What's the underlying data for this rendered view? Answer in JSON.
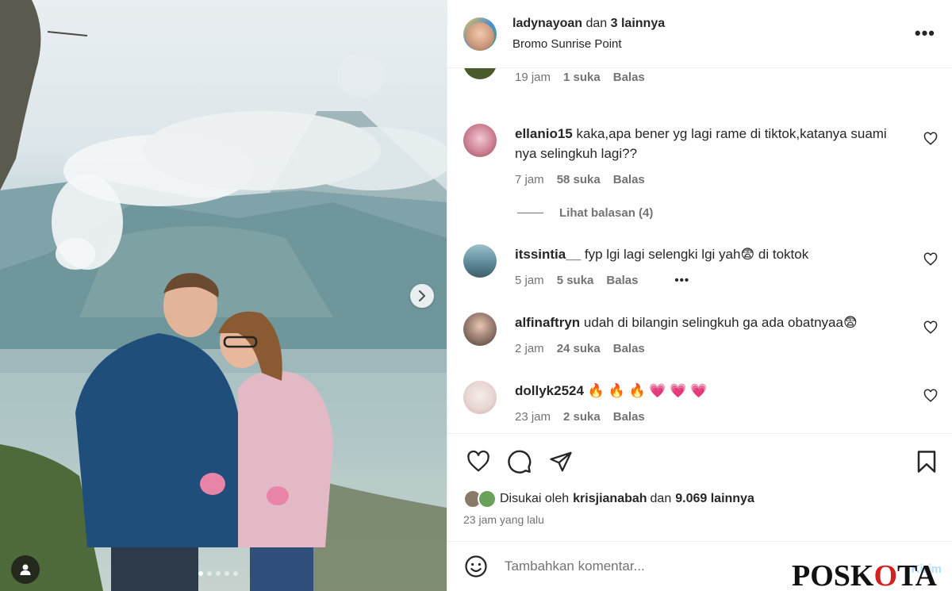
{
  "post": {
    "header_user": "ladynayoan",
    "header_and": "dan",
    "header_others": "3 lainnya",
    "location": "Bromo Sunrise Point",
    "more_icon": "more-horizontal-icon"
  },
  "comments": [
    {
      "username": "",
      "text": "",
      "time": "19 jam",
      "likes": "1 suka",
      "reply": "Balas",
      "avatar_color": "#4a5a2a"
    },
    {
      "username": "ellanio15",
      "text": "kaka,apa bener yg lagi rame di tiktok,katanya suami nya selingkuh lagi??",
      "time": "7 jam",
      "likes": "58 suka",
      "reply": "Balas",
      "avatar_color": "#c97b8e"
    },
    {
      "username": "itssintia__",
      "text": "fyp lgi lagi selengki lgi yah",
      "emoji": "😨",
      "text_after": "di toktok",
      "time": "5 jam",
      "likes": "5 suka",
      "reply": "Balas",
      "more": "•••",
      "avatar_color": "#5e8a9a"
    },
    {
      "username": "alfinaftryn",
      "text": "udah di bilangin selingkuh ga ada obatnyaa",
      "emoji": "😨",
      "time": "2 jam",
      "likes": "24 suka",
      "reply": "Balas",
      "avatar_color": "#6a5a52"
    },
    {
      "username": "dollyk2524",
      "text": "🔥 🔥 🔥 💗 💗 💗",
      "time": "23 jam",
      "likes": "2 suka",
      "reply": "Balas",
      "avatar_color": "#e8d6d2"
    }
  ],
  "replies_label": "Lihat balasan (4)",
  "actions": {
    "like_icon": "heart-icon",
    "comment_icon": "comment-icon",
    "share_icon": "send-icon",
    "save_icon": "bookmark-icon"
  },
  "likes": {
    "prefix": "Disukai oleh",
    "user": "krisjianabah",
    "and": "dan",
    "count": "9.069 lainnya"
  },
  "time_ago": "23 jam yang lalu",
  "add_comment": {
    "placeholder": "Tambahkan komentar...",
    "send_label": "Kirim"
  },
  "watermark": {
    "part1": "POSK",
    "part2": "O",
    "part3": "TA"
  },
  "colors": {
    "text": "#262626",
    "secondary": "#737373",
    "send_disabled": "#b2dffc"
  }
}
